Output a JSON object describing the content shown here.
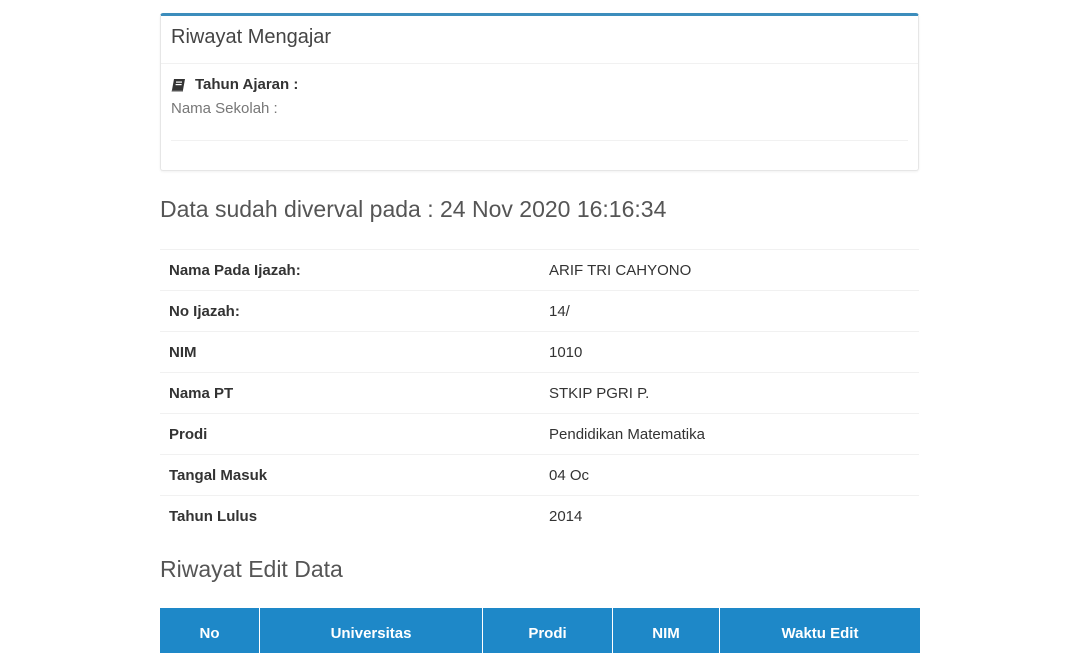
{
  "riwayat_mengajar": {
    "title": "Riwayat Mengajar",
    "tahun_ajaran_label": "Tahun Ajaran :",
    "nama_sekolah_label": "Nama Sekolah :"
  },
  "verval": {
    "text": "Data sudah diverval pada : 24 Nov 2020 16:16:34"
  },
  "ijazah": {
    "rows": [
      {
        "label": "Nama Pada Ijazah:",
        "value": "ARIF TRI CAHYONO"
      },
      {
        "label": "No Ijazah:",
        "value": "14/"
      },
      {
        "label": "NIM",
        "value": "1010"
      },
      {
        "label": "Nama PT",
        "value": "STKIP PGRI P."
      },
      {
        "label": "Prodi",
        "value": "Pendidikan Matematika"
      },
      {
        "label": "Tangal Masuk",
        "value": "04 Oc"
      },
      {
        "label": "Tahun Lulus",
        "value": "2014"
      }
    ]
  },
  "riwayat_edit": {
    "title": "Riwayat Edit Data",
    "columns": [
      "No",
      "Universitas",
      "Prodi",
      "NIM",
      "Waktu Edit"
    ]
  },
  "colors": {
    "panel_accent": "#3c8dbc",
    "table_header": "#1e88c8"
  },
  "icons": {
    "tahun_ajaran": "book-icon"
  }
}
